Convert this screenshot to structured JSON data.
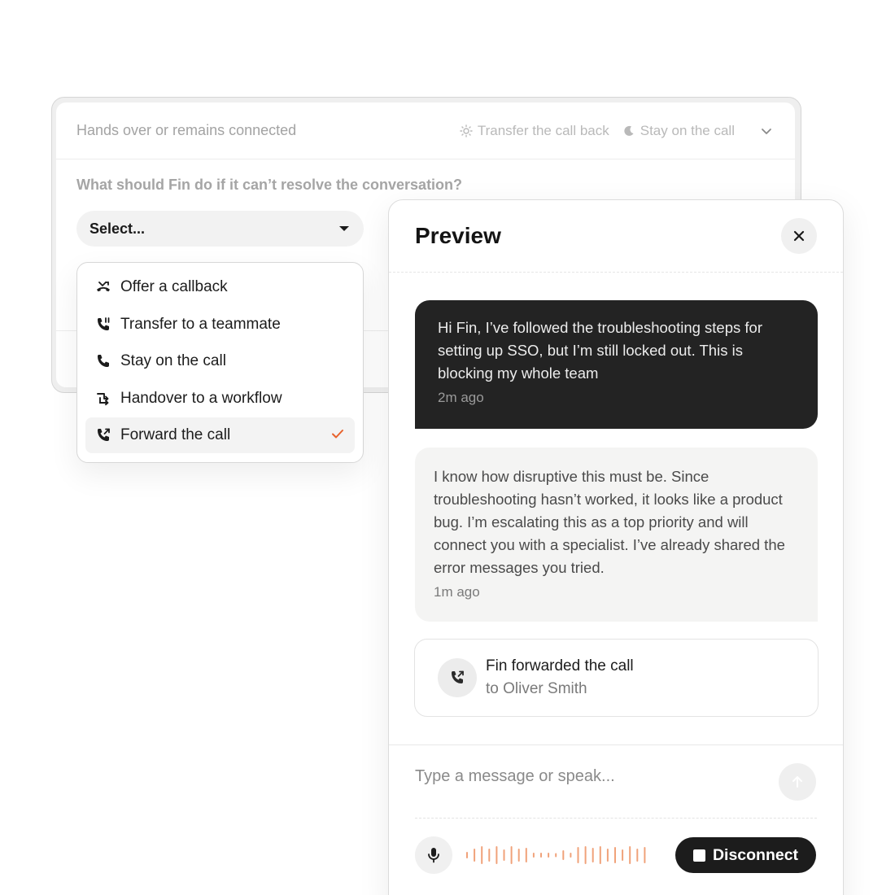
{
  "settings": {
    "title": "Hands over or remains connected",
    "options": [
      {
        "label": "Transfer the call back",
        "icon": "sun-icon"
      },
      {
        "label": "Stay on the call",
        "icon": "moon-icon"
      }
    ],
    "question": "What should Fin do if it can’t resolve the conversation?",
    "select_value": "Select..."
  },
  "dropdown": {
    "items": [
      {
        "label": "Offer a callback",
        "icon": "callback-icon"
      },
      {
        "label": "Transfer to a teammate",
        "icon": "phone-transfer-icon"
      },
      {
        "label": "Stay on the call",
        "icon": "phone-icon"
      },
      {
        "label": "Handover to a workflow",
        "icon": "workflow-icon"
      },
      {
        "label": "Forward the call",
        "icon": "phone-forward-icon",
        "selected": true
      }
    ],
    "accent_color": "#e8622c"
  },
  "preview": {
    "title": "Preview",
    "messages": [
      {
        "from": "user",
        "text": "Hi Fin, I’ve followed the troubleshooting steps for setting up SSO, but I’m still locked out. This is blocking my whole team",
        "time": "2m ago"
      },
      {
        "from": "fin",
        "text": "I know how disruptive this must be. Since troubleshooting hasn’t worked, it looks like a product bug. I’m escalating this as a top priority and will connect you with a specialist. I’ve already shared the error messages you tried.",
        "time": "1m ago"
      }
    ],
    "event": {
      "title": "Fin forwarded the call",
      "subtitle": "to Oliver Smith"
    },
    "composer_placeholder": "Type a message or speak...",
    "disconnect_label": "Disconnect",
    "waveform_color": "#f0a27a"
  }
}
